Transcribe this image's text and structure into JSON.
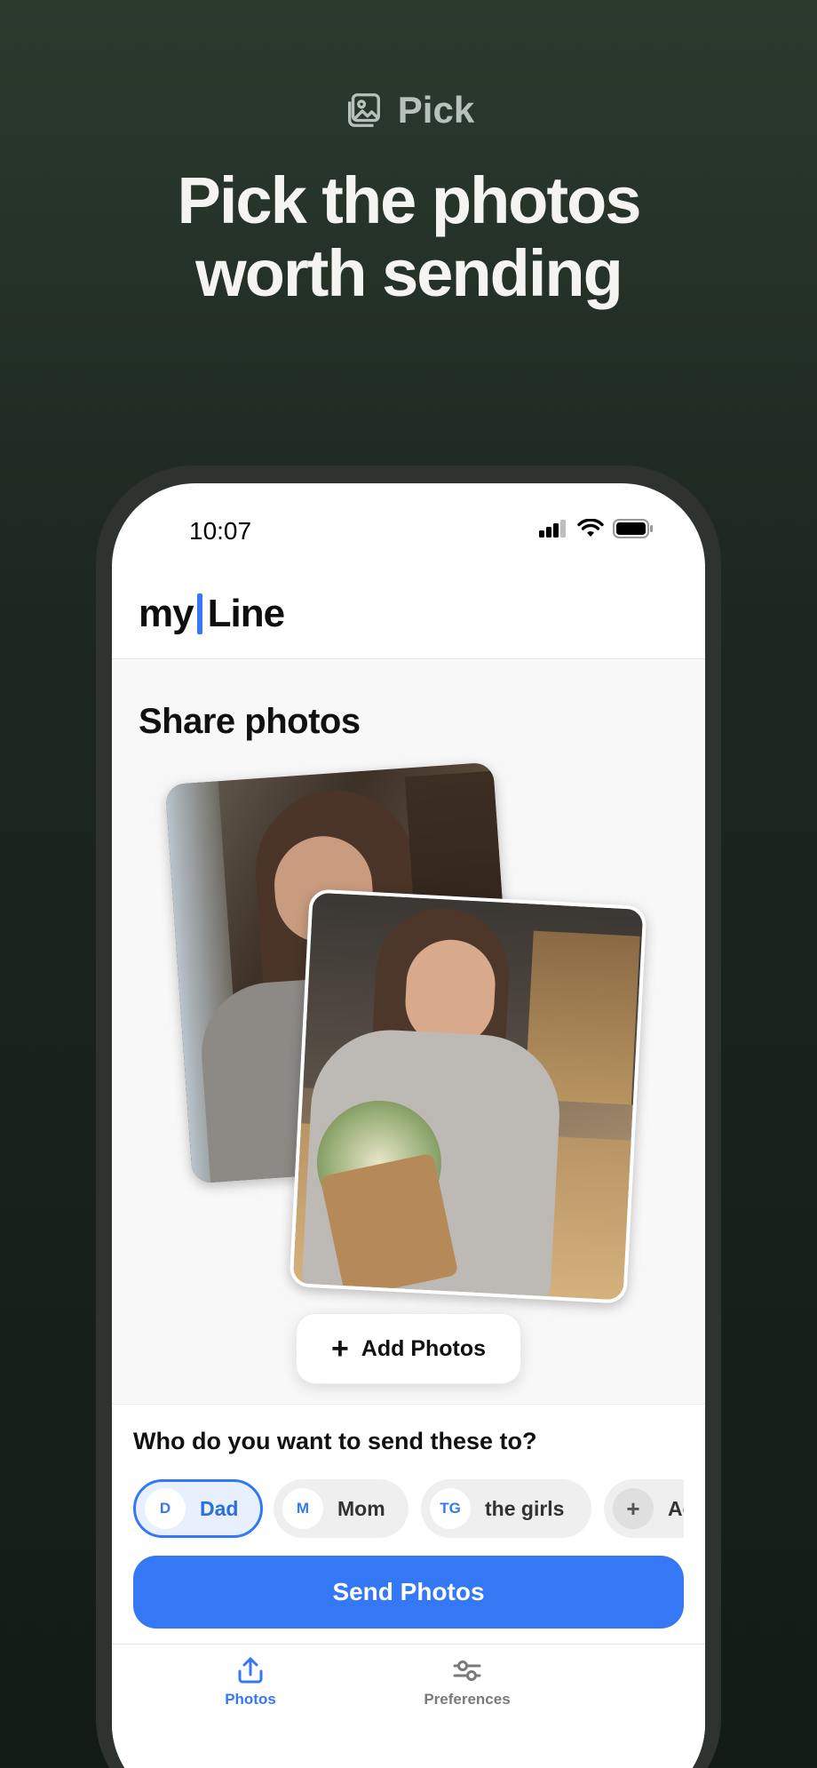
{
  "hero": {
    "tag": "Pick",
    "title_line1": "Pick the photos",
    "title_line2": "worth sending"
  },
  "status_bar": {
    "time": "10:07"
  },
  "app": {
    "logo_left": "my",
    "logo_right": "Line",
    "accent": "#3478f6"
  },
  "share": {
    "title": "Share photos",
    "add_photos_label": "Add Photos"
  },
  "recipients": {
    "question": "Who do you want to send these to?",
    "chips": [
      {
        "initial": "D",
        "name": "Dad",
        "selected": true
      },
      {
        "initial": "M",
        "name": "Mom",
        "selected": false
      },
      {
        "initial": "TG",
        "name": "the girls",
        "selected": false
      },
      {
        "initial": "+",
        "name": "Ad",
        "selected": false
      }
    ],
    "send_label": "Send Photos"
  },
  "tabs": [
    {
      "label": "Photos",
      "icon": "upload-icon",
      "active": true
    },
    {
      "label": "Preferences",
      "icon": "sliders-icon",
      "active": false
    }
  ]
}
